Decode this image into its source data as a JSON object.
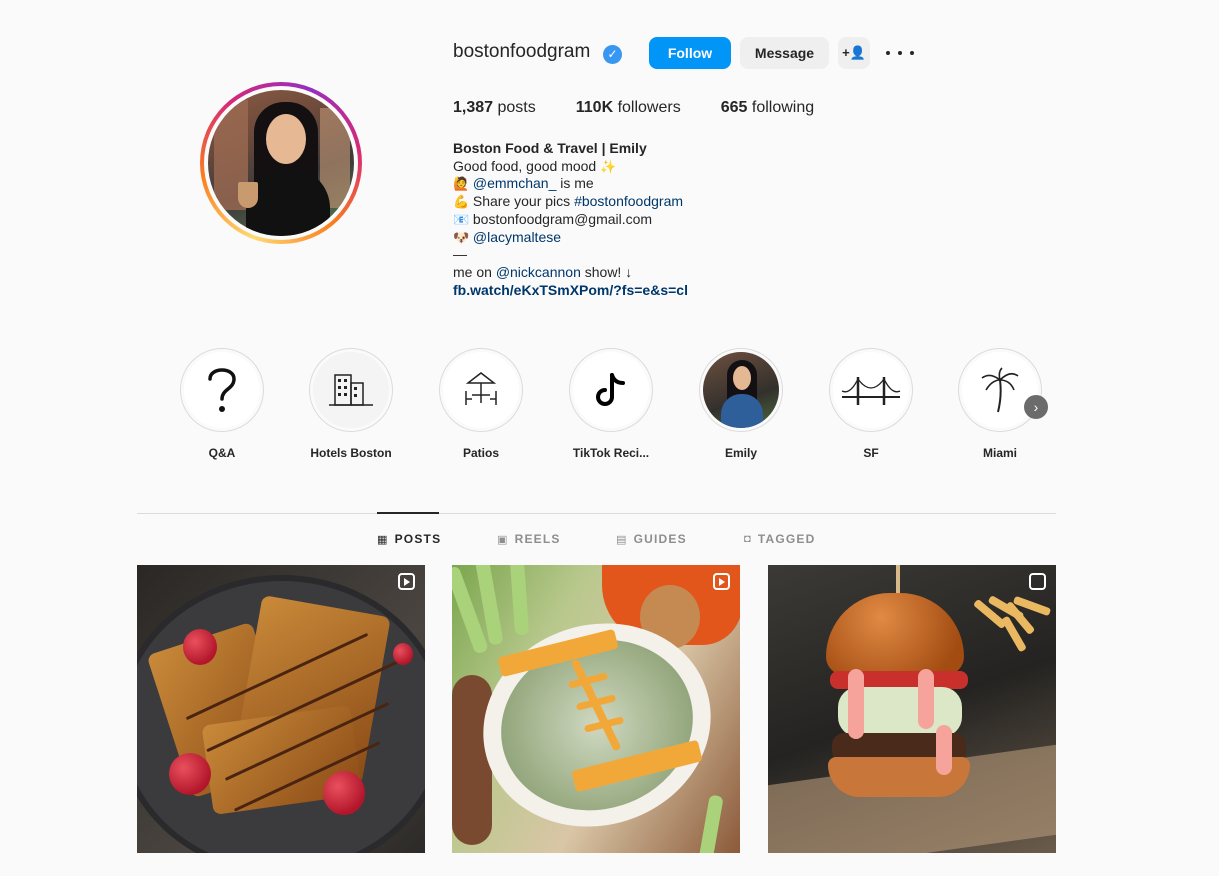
{
  "profile": {
    "username": "bostonfoodgram",
    "verified_glyph": "✓",
    "follow_label": "Follow",
    "message_label": "Message",
    "suggest_label": "+👤"
  },
  "stats": {
    "posts": "1,387",
    "posts_label": "posts",
    "followers": "110K",
    "followers_label": "followers",
    "following": "665",
    "following_label": "following"
  },
  "bio": {
    "name": "Boston Food & Travel | Emily",
    "line1": "Good food, good mood",
    "line1_emoji": "✨",
    "line2_emoji": "🙋",
    "line2_handle": "@emmchan_",
    "line2_rest": " is me",
    "line3_emoji": "💪",
    "line3_text": "Share your pics ",
    "line3_tag": "#bostonfoodgram",
    "line4_emoji": "📧",
    "line4_text": "bostonfoodgram@gmail.com",
    "line5_emoji": "🐶",
    "line5_handle": "@lacymaltese",
    "line6": "—",
    "line7_text": "me on ",
    "line7_handle": "@nickcannon",
    "line7_rest": " show! ↓",
    "link": "fb.watch/eKxTSmXPom/?fs=e&s=cl"
  },
  "highlights": [
    {
      "label": "Q&A",
      "icon": "question-icon"
    },
    {
      "label": "Hotels Boston",
      "icon": "hotel-icon"
    },
    {
      "label": "Patios",
      "icon": "patio-icon"
    },
    {
      "label": "TikTok Reci...",
      "icon": "tiktok-icon"
    },
    {
      "label": "Emily",
      "icon": "emily-photo"
    },
    {
      "label": "SF",
      "icon": "golden-gate-icon"
    },
    {
      "label": "Miami",
      "icon": "palm-tree-icon"
    }
  ],
  "tabs": [
    {
      "label": "POSTS",
      "icon": "grid-icon",
      "active": true
    },
    {
      "label": "REELS",
      "icon": "reels-icon",
      "active": false
    },
    {
      "label": "GUIDES",
      "icon": "guides-icon",
      "active": false
    },
    {
      "label": "TAGGED",
      "icon": "tagged-icon",
      "active": false
    }
  ],
  "posts": [
    {
      "subject": "french-toast",
      "badge": "reel"
    },
    {
      "subject": "spinach-dip-football",
      "badge": "reel"
    },
    {
      "subject": "burger",
      "badge": "carousel"
    }
  ],
  "colors": {
    "accent": "#0095f6",
    "link": "#00376b",
    "verified": "#3897f0"
  }
}
